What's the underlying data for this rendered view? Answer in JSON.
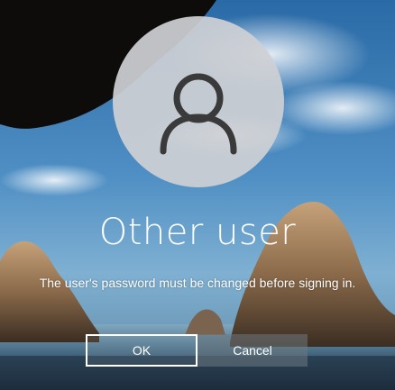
{
  "user": {
    "name": "Other user"
  },
  "message": {
    "text": "The user's password must be changed before signing in."
  },
  "buttons": {
    "ok_label": "OK",
    "cancel_label": "Cancel"
  },
  "icons": {
    "avatar": "user-silhouette-icon"
  },
  "colors": {
    "avatar_circle": "#cdd0d4",
    "avatar_glyph": "#3a3a3a",
    "text": "#ffffff",
    "ok_border": "#ffffff",
    "cancel_bg": "#6e7880"
  }
}
